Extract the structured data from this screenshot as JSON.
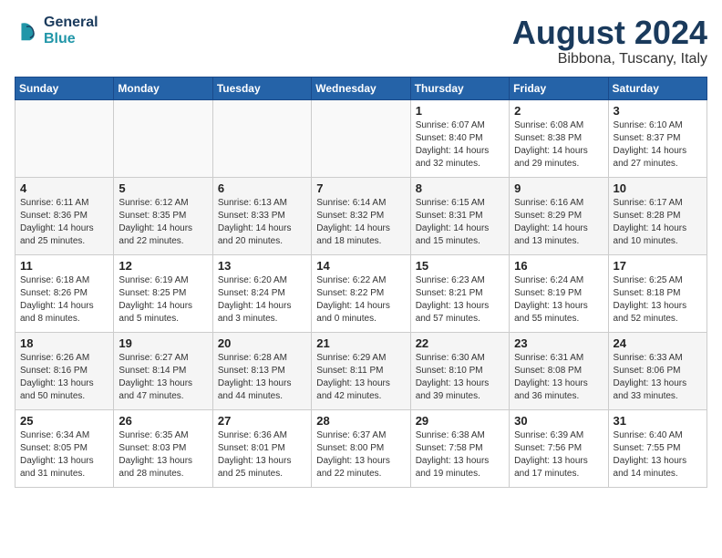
{
  "header": {
    "logo_line1": "General",
    "logo_line2": "Blue",
    "month_year": "August 2024",
    "location": "Bibbona, Tuscany, Italy"
  },
  "days_of_week": [
    "Sunday",
    "Monday",
    "Tuesday",
    "Wednesday",
    "Thursday",
    "Friday",
    "Saturday"
  ],
  "weeks": [
    [
      {
        "day": "",
        "info": ""
      },
      {
        "day": "",
        "info": ""
      },
      {
        "day": "",
        "info": ""
      },
      {
        "day": "",
        "info": ""
      },
      {
        "day": "1",
        "info": "Sunrise: 6:07 AM\nSunset: 8:40 PM\nDaylight: 14 hours\nand 32 minutes."
      },
      {
        "day": "2",
        "info": "Sunrise: 6:08 AM\nSunset: 8:38 PM\nDaylight: 14 hours\nand 29 minutes."
      },
      {
        "day": "3",
        "info": "Sunrise: 6:10 AM\nSunset: 8:37 PM\nDaylight: 14 hours\nand 27 minutes."
      }
    ],
    [
      {
        "day": "4",
        "info": "Sunrise: 6:11 AM\nSunset: 8:36 PM\nDaylight: 14 hours\nand 25 minutes."
      },
      {
        "day": "5",
        "info": "Sunrise: 6:12 AM\nSunset: 8:35 PM\nDaylight: 14 hours\nand 22 minutes."
      },
      {
        "day": "6",
        "info": "Sunrise: 6:13 AM\nSunset: 8:33 PM\nDaylight: 14 hours\nand 20 minutes."
      },
      {
        "day": "7",
        "info": "Sunrise: 6:14 AM\nSunset: 8:32 PM\nDaylight: 14 hours\nand 18 minutes."
      },
      {
        "day": "8",
        "info": "Sunrise: 6:15 AM\nSunset: 8:31 PM\nDaylight: 14 hours\nand 15 minutes."
      },
      {
        "day": "9",
        "info": "Sunrise: 6:16 AM\nSunset: 8:29 PM\nDaylight: 14 hours\nand 13 minutes."
      },
      {
        "day": "10",
        "info": "Sunrise: 6:17 AM\nSunset: 8:28 PM\nDaylight: 14 hours\nand 10 minutes."
      }
    ],
    [
      {
        "day": "11",
        "info": "Sunrise: 6:18 AM\nSunset: 8:26 PM\nDaylight: 14 hours\nand 8 minutes."
      },
      {
        "day": "12",
        "info": "Sunrise: 6:19 AM\nSunset: 8:25 PM\nDaylight: 14 hours\nand 5 minutes."
      },
      {
        "day": "13",
        "info": "Sunrise: 6:20 AM\nSunset: 8:24 PM\nDaylight: 14 hours\nand 3 minutes."
      },
      {
        "day": "14",
        "info": "Sunrise: 6:22 AM\nSunset: 8:22 PM\nDaylight: 14 hours\nand 0 minutes."
      },
      {
        "day": "15",
        "info": "Sunrise: 6:23 AM\nSunset: 8:21 PM\nDaylight: 13 hours\nand 57 minutes."
      },
      {
        "day": "16",
        "info": "Sunrise: 6:24 AM\nSunset: 8:19 PM\nDaylight: 13 hours\nand 55 minutes."
      },
      {
        "day": "17",
        "info": "Sunrise: 6:25 AM\nSunset: 8:18 PM\nDaylight: 13 hours\nand 52 minutes."
      }
    ],
    [
      {
        "day": "18",
        "info": "Sunrise: 6:26 AM\nSunset: 8:16 PM\nDaylight: 13 hours\nand 50 minutes."
      },
      {
        "day": "19",
        "info": "Sunrise: 6:27 AM\nSunset: 8:14 PM\nDaylight: 13 hours\nand 47 minutes."
      },
      {
        "day": "20",
        "info": "Sunrise: 6:28 AM\nSunset: 8:13 PM\nDaylight: 13 hours\nand 44 minutes."
      },
      {
        "day": "21",
        "info": "Sunrise: 6:29 AM\nSunset: 8:11 PM\nDaylight: 13 hours\nand 42 minutes."
      },
      {
        "day": "22",
        "info": "Sunrise: 6:30 AM\nSunset: 8:10 PM\nDaylight: 13 hours\nand 39 minutes."
      },
      {
        "day": "23",
        "info": "Sunrise: 6:31 AM\nSunset: 8:08 PM\nDaylight: 13 hours\nand 36 minutes."
      },
      {
        "day": "24",
        "info": "Sunrise: 6:33 AM\nSunset: 8:06 PM\nDaylight: 13 hours\nand 33 minutes."
      }
    ],
    [
      {
        "day": "25",
        "info": "Sunrise: 6:34 AM\nSunset: 8:05 PM\nDaylight: 13 hours\nand 31 minutes."
      },
      {
        "day": "26",
        "info": "Sunrise: 6:35 AM\nSunset: 8:03 PM\nDaylight: 13 hours\nand 28 minutes."
      },
      {
        "day": "27",
        "info": "Sunrise: 6:36 AM\nSunset: 8:01 PM\nDaylight: 13 hours\nand 25 minutes."
      },
      {
        "day": "28",
        "info": "Sunrise: 6:37 AM\nSunset: 8:00 PM\nDaylight: 13 hours\nand 22 minutes."
      },
      {
        "day": "29",
        "info": "Sunrise: 6:38 AM\nSunset: 7:58 PM\nDaylight: 13 hours\nand 19 minutes."
      },
      {
        "day": "30",
        "info": "Sunrise: 6:39 AM\nSunset: 7:56 PM\nDaylight: 13 hours\nand 17 minutes."
      },
      {
        "day": "31",
        "info": "Sunrise: 6:40 AM\nSunset: 7:55 PM\nDaylight: 13 hours\nand 14 minutes."
      }
    ]
  ]
}
